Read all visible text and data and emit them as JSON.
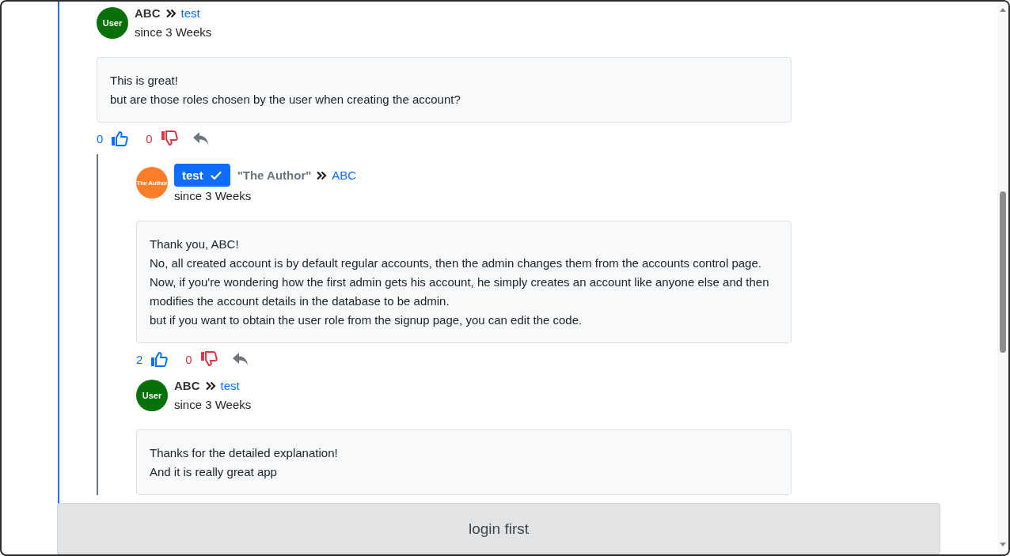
{
  "comments": [
    {
      "avatar": {
        "label": "User",
        "color": "#087008"
      },
      "author": "ABC",
      "badge": false,
      "reply_to": "test",
      "time": "since 3 Weeks",
      "body": [
        "This is great!",
        "but are those roles chosen by the user when creating the account?"
      ],
      "likes": "0",
      "dislikes": "0",
      "children": [
        {
          "avatar": {
            "label": "The Author",
            "color": "#fd7e2a"
          },
          "author": "test",
          "badge": true,
          "author_note": "\"The Author\"",
          "reply_to": "ABC",
          "time": "since 3 Weeks",
          "body": [
            "Thank you, ABC!",
            "No, all created account is by default regular accounts, then the admin changes them from the accounts control page.",
            "Now, if you're wondering how the first admin gets his account, he simply creates an account like anyone else and then modifies the account details in the database to be admin.",
            "but if you want to obtain the user role from the signup page, you can edit the code."
          ],
          "likes": "2",
          "dislikes": "0"
        },
        {
          "avatar": {
            "label": "User",
            "color": "#087008"
          },
          "author": "ABC",
          "badge": false,
          "reply_to": "test",
          "time": "since 3 Weeks",
          "body": [
            "Thanks for the detailed explanation!",
            "And it is really great app"
          ]
        }
      ]
    }
  ],
  "login_bar": {
    "label": "login first"
  }
}
